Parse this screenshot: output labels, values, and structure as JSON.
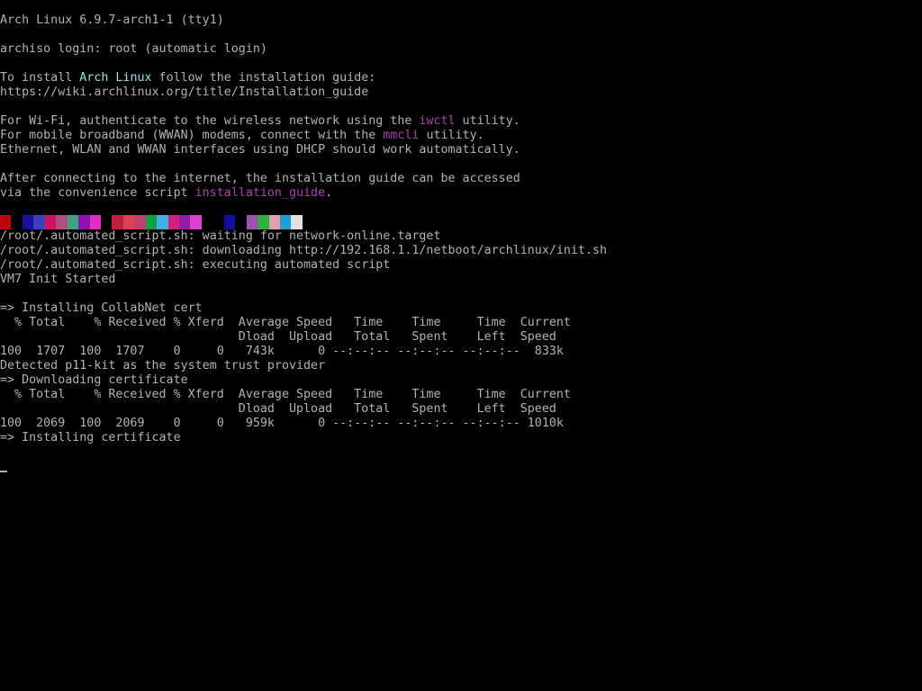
{
  "colors": {
    "background": "#000000",
    "text": "#b2b2b2",
    "highlight_cyan": "#8fe6e6",
    "highlight_magenta": "#b040b0"
  },
  "color_test_bar": {
    "blocks": [
      "#c0000c",
      "#000000",
      "#1a10a0",
      "#3a40c0",
      "#d01060",
      "#b05080",
      "#40a080",
      "#9010b0",
      "#e030c0",
      "#000000",
      "#c02040",
      "#e04050",
      "#c04070",
      "#10a040",
      "#40b0e0",
      "#d02080",
      "#9020a0",
      "#e040d0",
      "#000000",
      "#000000",
      "#1010a0",
      "#000000",
      "#a050b0",
      "#30b040",
      "#e0a0b0",
      "#20a0d0",
      "#e0e0e0"
    ]
  },
  "terminal": {
    "lines": [
      [
        {
          "t": "Arch Linux 6.9.7-arch1-1 (tty1)"
        }
      ],
      [],
      [
        {
          "t": "archiso login: root (automatic login)"
        }
      ],
      [],
      [
        {
          "t": "To install "
        },
        {
          "t": "Arch Linux",
          "c": "cyan"
        },
        {
          "t": " follow the installation guide:"
        }
      ],
      [
        {
          "t": "https://wiki.archlinux.org/title/Installation_guide"
        }
      ],
      [],
      [
        {
          "t": "For Wi-Fi, authenticate to the wireless network using the "
        },
        {
          "t": "iwctl",
          "c": "magenta"
        },
        {
          "t": " utility."
        }
      ],
      [
        {
          "t": "For mobile broadband (WWAN) modems, connect with the "
        },
        {
          "t": "mmcli",
          "c": "magenta"
        },
        {
          "t": " utility."
        }
      ],
      [
        {
          "t": "Ethernet, WLAN and WWAN interfaces using DHCP should work automatically."
        }
      ],
      [],
      [
        {
          "t": "After connecting to the internet, the installation guide can be accessed"
        }
      ],
      [
        {
          "t": "via the convenience script "
        },
        {
          "t": "installation_guide",
          "c": "magenta"
        },
        {
          "t": "."
        }
      ],
      [],
      "COLORBAR",
      [
        {
          "t": "/root/.automated_script.sh: waiting for network-online.target"
        }
      ],
      [
        {
          "t": "/root/.automated_script.sh: downloading http://192.168.1.1/netboot/archlinux/init.sh"
        }
      ],
      [
        {
          "t": "/root/.automated_script.sh: executing automated script"
        }
      ],
      [
        {
          "t": "VM7 Init Started"
        }
      ],
      [],
      [
        {
          "t": "=> Installing CollabNet cert"
        }
      ],
      [
        {
          "t": "  % Total    % Received % Xferd  Average Speed   Time    Time     Time  Current"
        }
      ],
      [
        {
          "t": "                                 Dload  Upload   Total   Spent    Left  Speed"
        }
      ],
      [
        {
          "t": "100  1707  100  1707    0     0   743k      0 --:--:-- --:--:-- --:--:--  833k"
        }
      ],
      [
        {
          "t": "Detected p11-kit as the system trust provider"
        }
      ],
      [
        {
          "t": "=> Downloading certificate"
        }
      ],
      [
        {
          "t": "  % Total    % Received % Xferd  Average Speed   Time    Time     Time  Current"
        }
      ],
      [
        {
          "t": "                                 Dload  Upload   Total   Spent    Left  Speed"
        }
      ],
      [
        {
          "t": "100  2069  100  2069    0     0   959k      0 --:--:-- --:--:-- --:--:-- 1010k"
        }
      ],
      [
        {
          "t": "=> Installing certificate"
        }
      ],
      [],
      "CURSOR"
    ]
  }
}
